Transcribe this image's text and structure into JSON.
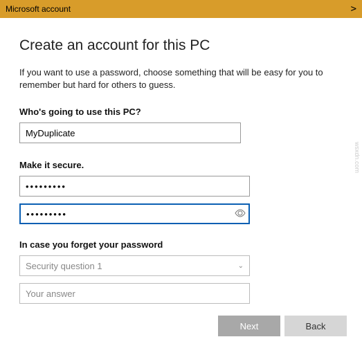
{
  "titlebar": {
    "title": "Microsoft account"
  },
  "page": {
    "heading": "Create an account for this PC",
    "description": "If you want to use a password, choose something that will be easy for you to remember but hard for others to guess."
  },
  "who": {
    "label": "Who's going to use this PC?",
    "value": "MyDuplicate"
  },
  "secure": {
    "label": "Make it secure.",
    "password1": "•••••••••",
    "password2": "•••••••••"
  },
  "forgot": {
    "label": "In case you forget your password",
    "select_placeholder": "Security question 1",
    "answer_placeholder": "Your answer"
  },
  "footer": {
    "next": "Next",
    "back": "Back"
  },
  "watermark": "wsxdn.com"
}
